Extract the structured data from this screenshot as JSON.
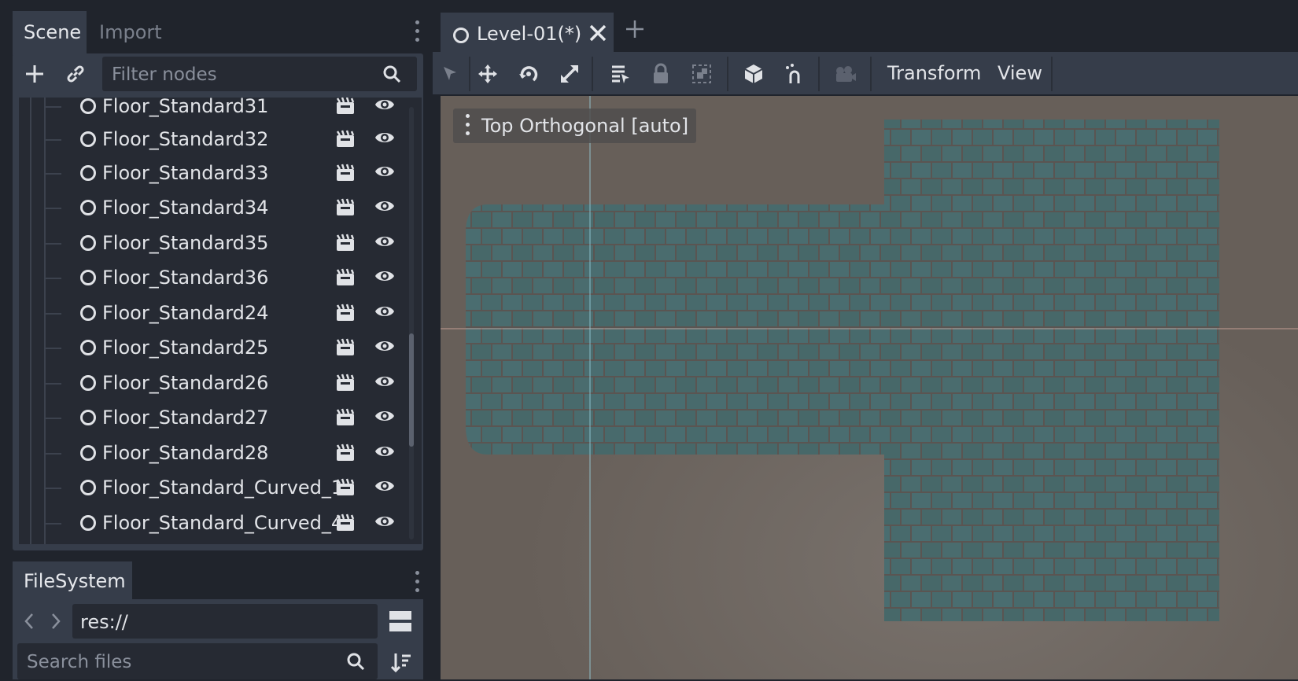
{
  "scene_dock": {
    "tabs": [
      "Scene",
      "Import"
    ],
    "filter_placeholder": "Filter nodes",
    "nodes": [
      "Floor_Standard31",
      "Floor_Standard32",
      "Floor_Standard33",
      "Floor_Standard34",
      "Floor_Standard35",
      "Floor_Standard36",
      "Floor_Standard24",
      "Floor_Standard25",
      "Floor_Standard26",
      "Floor_Standard27",
      "Floor_Standard28",
      "Floor_Standard_Curved_1",
      "Floor_Standard_Curved_4"
    ]
  },
  "filesystem_dock": {
    "tab": "FileSystem",
    "path": "res://",
    "search_placeholder": "Search files"
  },
  "editor": {
    "scene_tab": "Level-01(*)",
    "toolbar_menus": [
      "Transform",
      "View"
    ],
    "viewport_label": "Top Orthogonal [auto]"
  },
  "colors": {
    "panel": "#363d4a",
    "background": "#20242c",
    "viewport_floor": "#675f59",
    "tile": "#486a6c",
    "tile_grout": "#5a5552"
  }
}
